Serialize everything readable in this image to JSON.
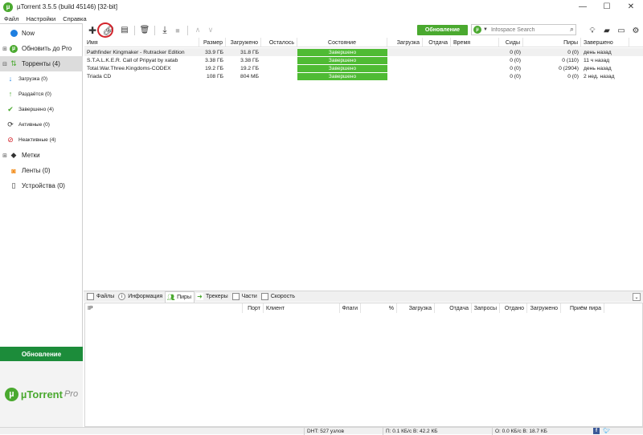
{
  "window": {
    "title": "µTorrent 3.5.5  (build 45146) [32-bit]",
    "minimize_glyph": "—",
    "maximize_glyph": "☐",
    "close_glyph": "✕"
  },
  "menu": [
    "Файл",
    "Настройки",
    "Справка"
  ],
  "sidebar": {
    "items": [
      {
        "label": "Now",
        "icon": "now-icon"
      },
      {
        "label": "Обновить до Pro",
        "icon": "utorrent-pro-icon"
      },
      {
        "label": "Торренты (4)",
        "icon": "torrents-icon"
      },
      {
        "label": "Загрузка (0)",
        "icon": "download-arrow-icon"
      },
      {
        "label": "Раздаётся (0)",
        "icon": "upload-arrow-icon"
      },
      {
        "label": "Завершено (4)",
        "icon": "checkmark-icon"
      },
      {
        "label": "Активные (0)",
        "icon": "active-refresh-icon"
      },
      {
        "label": "Неактивные (4)",
        "icon": "inactive-icon"
      },
      {
        "label": "Метки",
        "icon": "label-tag-icon"
      },
      {
        "label": "Ленты (0)",
        "icon": "rss-feed-icon"
      },
      {
        "label": "Устройства (0)",
        "icon": "device-icon"
      }
    ],
    "upgrade_label": "Обновление",
    "promo_brand": "µTorrent",
    "promo_pro": "Pro"
  },
  "toolbar": {
    "update_label": "Обновление",
    "search_placeholder": "Infospace Search"
  },
  "torrent_table": {
    "columns": [
      "Имя",
      "Размер",
      "Загружено",
      "Осталось",
      "Состояние",
      "Загрузка",
      "Отдача",
      "Время",
      "Сиды",
      "Пиры",
      "Завершено"
    ],
    "rows": [
      {
        "name": "Pathfinder Kingmaker - Rutracker Edition",
        "size": "33.9 ГБ",
        "downloaded": "31.8 ГБ",
        "remaining": "",
        "status": "Завершено",
        "seeds": "0 (0)",
        "peers": "0 (0)",
        "completed": "день назад"
      },
      {
        "name": "S.T.A.L.K.E.R. Call of Pripyat by xatab",
        "size": "3.38 ГБ",
        "downloaded": "3.38 ГБ",
        "remaining": "",
        "status": "Завершено",
        "seeds": "0 (0)",
        "peers": "0 (110)",
        "completed": "11 ч назад"
      },
      {
        "name": "Total.War.Three.Kingdoms-CODEX",
        "size": "19.2 ГБ",
        "downloaded": "19.2 ГБ",
        "remaining": "",
        "status": "Завершено",
        "seeds": "0 (0)",
        "peers": "0 (2904)",
        "completed": "день назад"
      },
      {
        "name": "Triada CD",
        "size": "108 ГБ",
        "downloaded": "804 МБ",
        "remaining": "",
        "status": "Завершено",
        "seeds": "0 (0)",
        "peers": "0 (0)",
        "completed": "2 нед. назад"
      }
    ]
  },
  "detail_tabs": [
    "Файлы",
    "Информация",
    "Пиры",
    "Трекеры",
    "Части",
    "Скорость"
  ],
  "peers_table": {
    "columns": [
      "IP",
      "Порт",
      "Клиент",
      "Флаги",
      "%",
      "Загрузка",
      "Отдача",
      "Запросы",
      "Отдано",
      "Загружено",
      "Приём пира"
    ]
  },
  "statusbar": {
    "dht": "DHT: 527 узлов",
    "download": "П: 0.1 КБ/с В: 42.2 КБ",
    "upload": "О: 0.0 КБ/с В: 18.7 КБ"
  },
  "colors": {
    "brand_green": "#4aa92f",
    "status_green": "#4fbb34",
    "sidebar_upgrade": "#1c8c3a",
    "highlight_circle": "#d3242c"
  }
}
